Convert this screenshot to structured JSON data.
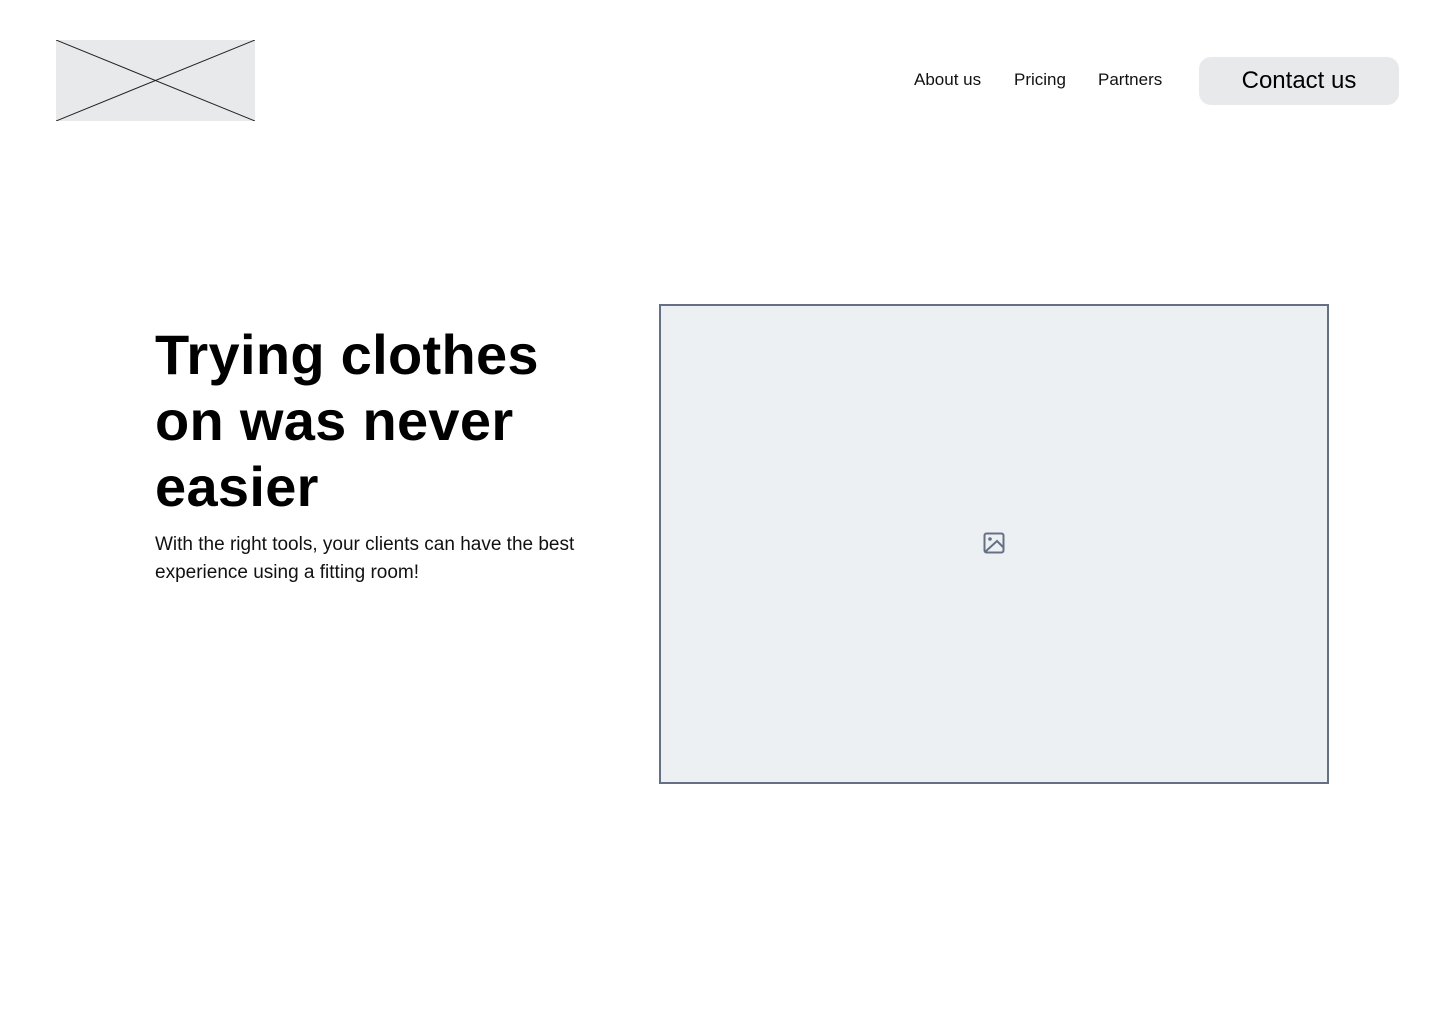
{
  "header": {
    "logo_icon": "placeholder-image-x",
    "nav": [
      {
        "label": "About us"
      },
      {
        "label": "Pricing"
      },
      {
        "label": "Partners"
      }
    ],
    "contact_label": "Contact us"
  },
  "hero": {
    "headline": "Trying clothes on was never easier",
    "subtext": "With the right tools, your clients can have the best experience using a fitting room!",
    "image_icon": "image-icon"
  },
  "colors": {
    "placeholder_bg": "#edf0f3",
    "placeholder_border": "#667085",
    "button_bg": "#e8e9eb"
  }
}
